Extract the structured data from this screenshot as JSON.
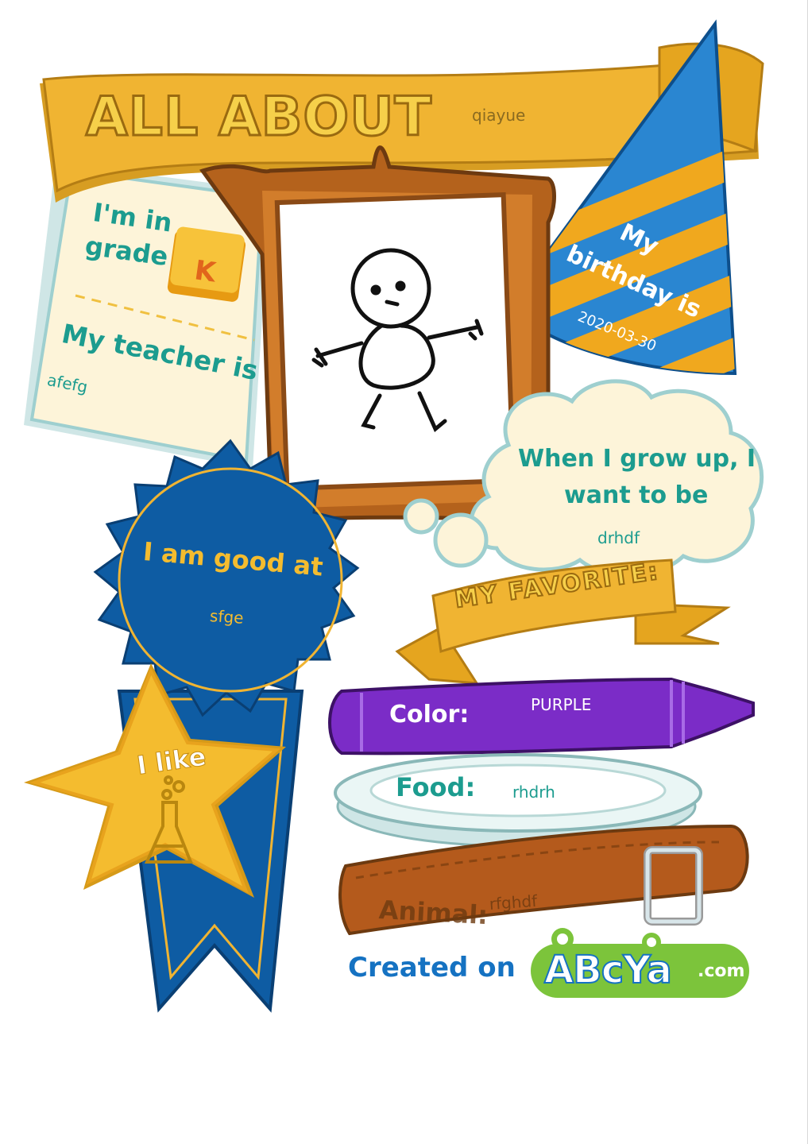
{
  "header": {
    "title": "ALL ABOUT",
    "name": "qiayue"
  },
  "grade": {
    "label_line1": "I'm in",
    "label_line2": "grade",
    "value": "K"
  },
  "teacher": {
    "label": "My teacher is",
    "value": "afefg"
  },
  "birthday": {
    "label_line1": "My",
    "label_line2": "birthday is",
    "value": "2020-03-30"
  },
  "grow_up": {
    "label_line1": "When I grow up, I",
    "label_line2": "want to be",
    "value": "drhdf"
  },
  "good_at": {
    "label": "I am good at",
    "value": "sfge"
  },
  "favorite": {
    "banner": "MY FAVORITE:",
    "color_label": "Color:",
    "color_value": "PURPLE",
    "food_label": "Food:",
    "food_value": "rhdrh",
    "animal_label": "Animal:",
    "animal_value": "rfghdf"
  },
  "likes": {
    "label": "I like",
    "icon": "flask-icon"
  },
  "footer": {
    "created_on": "Created on",
    "logo_text": "ABcYa",
    "logo_suffix": ".com"
  },
  "colors": {
    "gold": "#f2b62a",
    "teal": "#1c9c8f",
    "blue": "#0e5ca3",
    "purple": "#7b2cc7",
    "brown": "#b45a1c"
  }
}
